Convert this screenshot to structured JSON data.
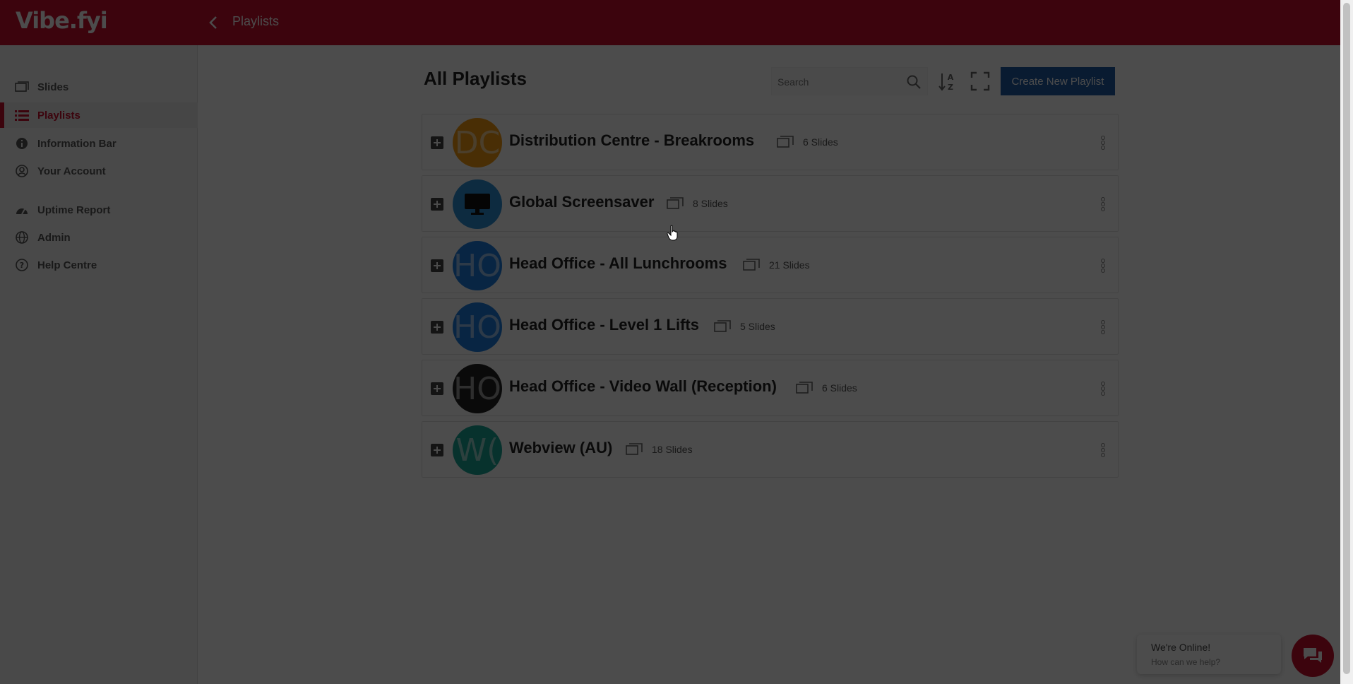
{
  "app": {
    "logo": "Vibe.fyi",
    "header_title": "Playlists"
  },
  "sidebar": {
    "items": [
      {
        "label": "Slides",
        "icon": "slides-icon",
        "active": false
      },
      {
        "label": "Playlists",
        "icon": "list-icon",
        "active": true
      },
      {
        "label": "Information Bar",
        "icon": "info-icon",
        "active": false
      },
      {
        "label": "Your Account",
        "icon": "user-circle-icon",
        "active": false
      },
      {
        "label": "Uptime Report",
        "icon": "gauge-icon",
        "active": false
      },
      {
        "label": "Admin",
        "icon": "globe-icon",
        "active": false
      },
      {
        "label": "Help Centre",
        "icon": "question-icon",
        "active": false
      }
    ]
  },
  "main": {
    "title": "All Playlists",
    "search_placeholder": "Search",
    "create_button": "Create New Playlist",
    "playlists": [
      {
        "initials": "DC",
        "name": "Distribution Centre - Breakrooms",
        "slides": "6 Slides",
        "color": "#f39c12"
      },
      {
        "initials": "",
        "name": "Global Screensaver",
        "slides": "8 Slides",
        "color": "#2d8fd6",
        "icon": "monitor-icon"
      },
      {
        "initials": "HO",
        "name": "Head Office - All Lunchrooms",
        "slides": "21 Slides",
        "color": "#1c7ce0"
      },
      {
        "initials": "HO",
        "name": "Head Office - Level 1 Lifts",
        "slides": "5 Slides",
        "color": "#1c7ce0"
      },
      {
        "initials": "HO",
        "name": "Head Office - Video Wall (Reception)",
        "slides": "6 Slides",
        "color": "#222222"
      },
      {
        "initials": "W(",
        "name": "Webview (AU)",
        "slides": "18 Slides",
        "color": "#1aa898"
      }
    ]
  },
  "chat": {
    "title": "We're Online!",
    "subtitle": "How can we help?"
  },
  "colors": {
    "brand": "#c8102e",
    "primary_button": "#1f5aa6"
  }
}
